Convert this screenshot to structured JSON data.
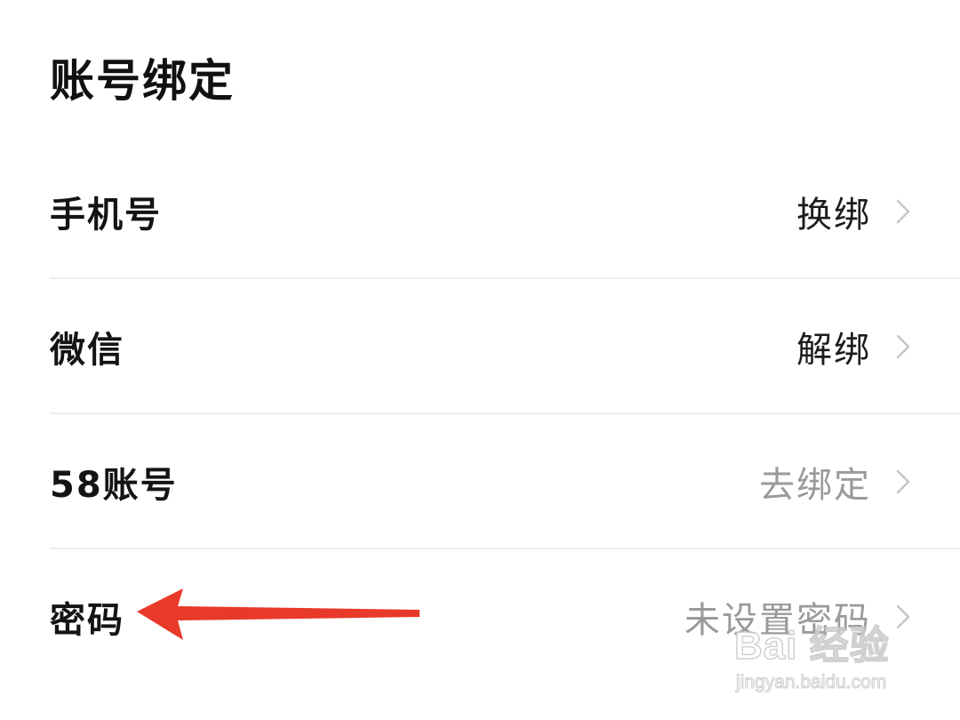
{
  "section": {
    "title": "账号绑定"
  },
  "rows": [
    {
      "label": "手机号",
      "value": "换绑",
      "value_tone": "dark"
    },
    {
      "label": "微信",
      "value": "解绑",
      "value_tone": "dark"
    },
    {
      "label": "58账号",
      "value": "去绑定",
      "value_tone": "grey"
    },
    {
      "label": "密码",
      "value": "未设置密码",
      "value_tone": "grey"
    }
  ],
  "annotation": {
    "arrow_color": "#e8392a",
    "icon": "left-arrow-icon"
  },
  "watermark": {
    "logo_text": "Bai 经验",
    "url": "jingyan.baidu.com"
  },
  "colors": {
    "text_primary": "#1a1a1a",
    "text_secondary": "#9a9a9a",
    "divider": "#ececec",
    "chevron": "#c6c6c6"
  }
}
